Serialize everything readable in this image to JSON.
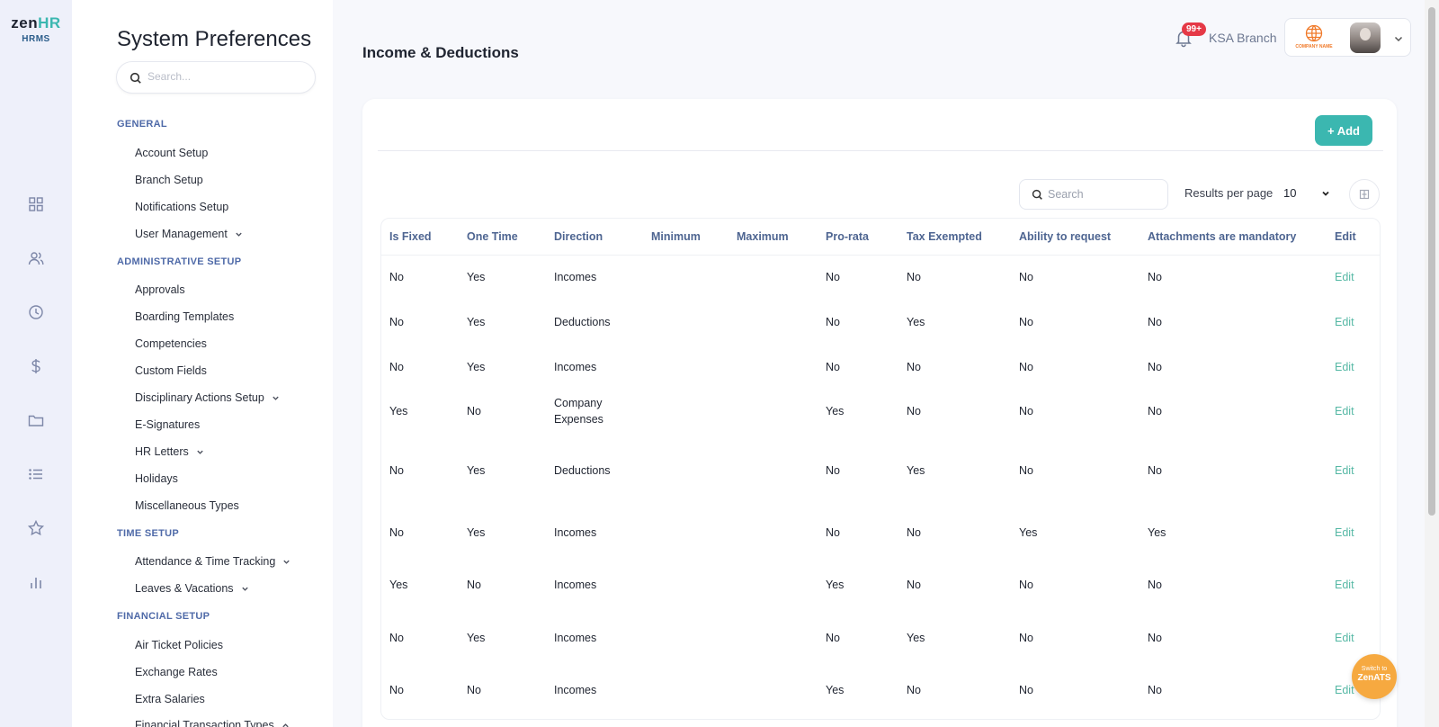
{
  "brand": {
    "logo_main": "zen",
    "logo_accent": "HR",
    "logo_sub": "HRMS"
  },
  "rail_icons": [
    "dashboard-icon",
    "people-icon",
    "clock-icon",
    "dollar-icon",
    "folder-icon",
    "list-icon",
    "star-icon",
    "bar-chart-icon"
  ],
  "sidebar": {
    "title": "System Preferences",
    "search_placeholder": "Search...",
    "sections": [
      {
        "title": "GENERAL",
        "items": [
          {
            "label": "Account Setup"
          },
          {
            "label": "Branch Setup"
          },
          {
            "label": "Notifications Setup"
          },
          {
            "label": "User Management",
            "expandable": true
          }
        ]
      },
      {
        "title": "ADMINISTRATIVE SETUP",
        "items": [
          {
            "label": "Approvals"
          },
          {
            "label": "Boarding Templates"
          },
          {
            "label": "Competencies"
          },
          {
            "label": "Custom Fields"
          },
          {
            "label": "Disciplinary Actions Setup",
            "expandable": true
          },
          {
            "label": "E-Signatures"
          },
          {
            "label": "HR Letters",
            "expandable": true
          },
          {
            "label": "Holidays"
          },
          {
            "label": "Miscellaneous Types"
          }
        ]
      },
      {
        "title": "TIME SETUP",
        "items": [
          {
            "label": "Attendance & Time Tracking",
            "expandable": true
          },
          {
            "label": "Leaves & Vacations",
            "expandable": true
          }
        ]
      },
      {
        "title": "FINANCIAL SETUP",
        "items": [
          {
            "label": "Air Ticket Policies"
          },
          {
            "label": "Exchange Rates"
          },
          {
            "label": "Extra Salaries"
          },
          {
            "label": "Financial Transaction Types",
            "expandable": true
          }
        ]
      }
    ]
  },
  "header": {
    "page_title": "Income & Deductions",
    "notification_badge": "99+",
    "branch": "KSA Branch",
    "company_logo_text": "COMPANY NAME"
  },
  "toolbar": {
    "add_label": "+ Add",
    "search_placeholder": "Search",
    "results_per_page_label": "Results per page",
    "results_per_page_value": "10"
  },
  "table": {
    "columns": [
      "Is Fixed",
      "One Time",
      "Direction",
      "Minimum",
      "Maximum",
      "Pro-rata",
      "Tax Exempted",
      "Ability to request",
      "Attachments are mandatory",
      "Edit"
    ],
    "rows": [
      [
        "No",
        "Yes",
        "Incomes",
        "",
        "",
        "No",
        "No",
        "No",
        "No",
        "Edit"
      ],
      [
        "No",
        "Yes",
        "Deductions",
        "",
        "",
        "No",
        "Yes",
        "No",
        "No",
        "Edit"
      ],
      [
        "No",
        "Yes",
        "Incomes",
        "",
        "",
        "No",
        "No",
        "No",
        "No",
        "Edit"
      ],
      [
        "Yes",
        "No",
        "Company Expenses",
        "",
        "",
        "Yes",
        "No",
        "No",
        "No",
        "Edit"
      ],
      [
        "No",
        "Yes",
        "Deductions",
        "",
        "",
        "No",
        "Yes",
        "No",
        "No",
        "Edit"
      ],
      [
        "No",
        "Yes",
        "Incomes",
        "",
        "",
        "No",
        "No",
        "Yes",
        "Yes",
        "Edit"
      ],
      [
        "Yes",
        "No",
        "Incomes",
        "",
        "",
        "Yes",
        "No",
        "No",
        "No",
        "Edit"
      ],
      [
        "No",
        "Yes",
        "Incomes",
        "",
        "",
        "No",
        "Yes",
        "No",
        "No",
        "Edit"
      ],
      [
        "No",
        "No",
        "Incomes",
        "",
        "",
        "Yes",
        "No",
        "No",
        "No",
        "Edit"
      ]
    ]
  },
  "switch_button": {
    "line1": "Switch to",
    "line2": "ZenATS"
  },
  "colors": {
    "accent": "#3bb7b0",
    "badge": "#e53946",
    "switch": "#f6a940",
    "section_title": "#4f6aa8"
  }
}
